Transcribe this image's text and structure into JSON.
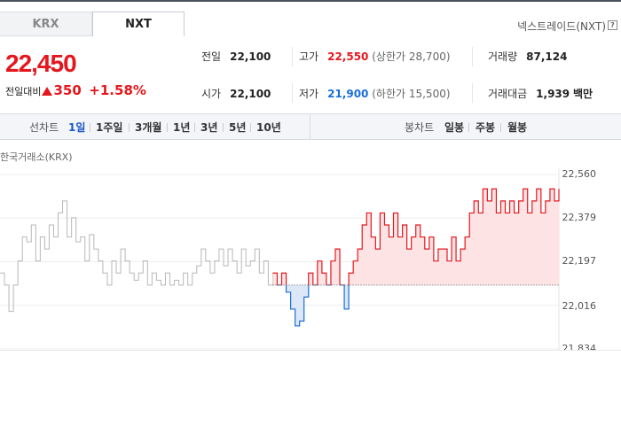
{
  "tabs": [
    {
      "label": "KRX",
      "active": false
    },
    {
      "label": "NXT",
      "active": true
    }
  ],
  "nxt_link": "넥스트레이드(NXT)",
  "help_glyph": "?",
  "price": {
    "current": "22,450",
    "diff_label": "전일대비",
    "diff_value": "350",
    "diff_pct": "+1.58%"
  },
  "stats": {
    "prev_label": "전일",
    "prev_value": "22,100",
    "open_label": "시가",
    "open_value": "22,100",
    "high_label": "고가",
    "high_value": "22,550",
    "upper_limit": "(상한가 28,700)",
    "low_label": "저가",
    "low_value": "21,900",
    "lower_limit": "(하한가 15,500)",
    "volume_label": "거래량",
    "volume_value": "87,124",
    "amount_label": "거래대금",
    "amount_value": "1,939",
    "amount_unit": "백만"
  },
  "period": {
    "line_title": "선차트",
    "line_items": [
      "1일",
      "1주일",
      "3개월",
      "1년",
      "3년",
      "5년",
      "10년"
    ],
    "line_active": 0,
    "candle_title": "봉차트",
    "candle_items": [
      "일봉",
      "주봉",
      "월봉"
    ]
  },
  "chart_source": "한국거래소(KRX)",
  "colors": {
    "up": "#e5171e",
    "down": "#1a6ed8",
    "gray": "#b8b8b8",
    "up_fill": "#fde3e3",
    "down_fill": "#dce8f7"
  },
  "chart_data": {
    "type": "line",
    "title": "",
    "y_ticks": [
      "22,560",
      "22,379",
      "22,197",
      "22,016",
      "21,834"
    ],
    "ylim": [
      21834,
      22560
    ],
    "baseline": 22100,
    "series": [
      {
        "segment": "krx",
        "values": [
          22150,
          22100,
          21990,
          22100,
          22200,
          22300,
          22280,
          22350,
          22200,
          22300,
          22250,
          22350,
          22300,
          22400,
          22450,
          22300,
          22380,
          22280,
          22300,
          22200,
          22310,
          22250,
          22200,
          22150,
          22100,
          22200,
          22150,
          22250,
          22200,
          22150,
          22120,
          22150,
          22200,
          22100,
          22150,
          22120,
          22100,
          22150,
          22100,
          22120,
          22100,
          22150,
          22100,
          22150,
          22180,
          22250,
          22200,
          22150,
          22200,
          22250,
          22180,
          22250,
          22200,
          22150,
          22250,
          22180,
          22200,
          22250,
          22150,
          22200,
          22100,
          22150
        ]
      },
      {
        "segment": "nxt",
        "values": [
          22100,
          22150,
          22070,
          22000,
          21930,
          21950,
          22050,
          22150,
          22100,
          22200,
          22150,
          22100,
          22200,
          22250,
          22100,
          22000,
          22150,
          22200,
          22250,
          22350,
          22400,
          22300,
          22250,
          22400,
          22350,
          22300,
          22400,
          22300,
          22350,
          22250,
          22300,
          22350,
          22300,
          22250,
          22300,
          22200,
          22250,
          22250,
          22200,
          22300,
          22200,
          22250,
          22300,
          22400,
          22450,
          22400,
          22500,
          22450,
          22500,
          22400,
          22450,
          22400,
          22450,
          22400,
          22450,
          22500,
          22400,
          22450,
          22500,
          22400,
          22450,
          22500,
          22450,
          22500
        ]
      }
    ]
  }
}
